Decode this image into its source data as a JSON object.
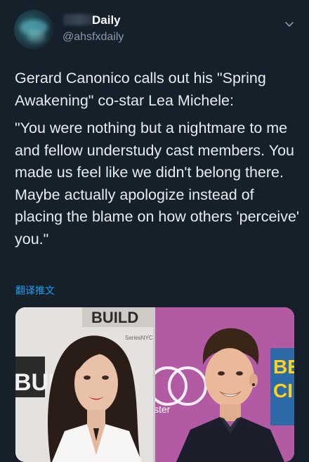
{
  "account": {
    "display_name": "Daily",
    "handle": "@ahsfxdaily"
  },
  "tweet": {
    "intro": "Gerard Canonico calls out his \"Spring Awakening\" co-star Lea Michele:",
    "quote": "\"You were nothing but a nightmare to me and fellow understudy cast members. You made us feel like we didn't belong there. Maybe actually apologize instead of placing the blame on how others 'perceive' you.\"",
    "translate_label": "翻译推文"
  },
  "media": {
    "left_backdrop": [
      "BUILD",
      "SeriesNYC",
      "BUIL"
    ],
    "right_backdrop": [
      "BE",
      "CI",
      "ster"
    ]
  },
  "icons": {
    "chevron": "chevron-down-icon"
  },
  "colors": {
    "background": "#15202b",
    "text": "#e6ecf0",
    "secondary_text": "#8899a6",
    "link": "#1da1f2"
  }
}
